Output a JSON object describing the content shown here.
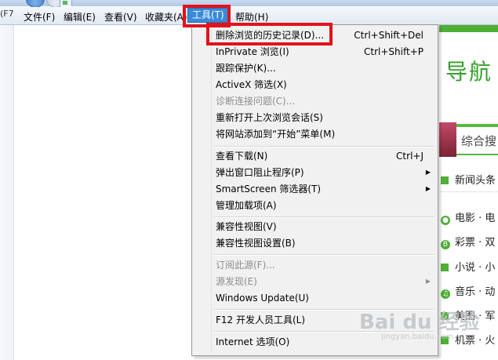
{
  "window": {
    "side_label": "(F7"
  },
  "menubar": {
    "items": [
      {
        "label": "文件(F)"
      },
      {
        "label": "编辑(E)"
      },
      {
        "label": "查看(V)"
      },
      {
        "label": "收藏夹(A)"
      },
      {
        "label": "工具(T)"
      },
      {
        "label": "帮助(H)"
      }
    ]
  },
  "tools_menu": {
    "items": [
      {
        "label": "删除浏览的历史记录(D)...",
        "shortcut": "Ctrl+Shift+Del",
        "disabled": false
      },
      {
        "label": "InPrivate 浏览(I)",
        "shortcut": "Ctrl+Shift+P",
        "disabled": false
      },
      {
        "label": "跟踪保护(K)...",
        "shortcut": "",
        "disabled": false
      },
      {
        "label": "ActiveX 筛选(X)",
        "shortcut": "",
        "disabled": false
      },
      {
        "label": "诊断连接问题(C)...",
        "shortcut": "",
        "disabled": true
      },
      {
        "label": "重新打开上次浏览会话(S)",
        "shortcut": "",
        "disabled": false
      },
      {
        "label": "将网站添加到“开始”菜单(M)",
        "shortcut": "",
        "disabled": false
      },
      {
        "label": "查看下载(N)",
        "shortcut": "Ctrl+J",
        "disabled": false
      },
      {
        "label": "弹出窗口阻止程序(P)",
        "shortcut": "",
        "submenu": true,
        "disabled": false
      },
      {
        "label": "SmartScreen 筛选器(T)",
        "shortcut": "",
        "submenu": true,
        "disabled": false
      },
      {
        "label": "管理加载项(A)",
        "shortcut": "",
        "disabled": false
      },
      {
        "label": "兼容性视图(V)",
        "shortcut": "",
        "disabled": false
      },
      {
        "label": "兼容性视图设置(B)",
        "shortcut": "",
        "disabled": false
      },
      {
        "label": "订阅此源(F)...",
        "shortcut": "",
        "disabled": true
      },
      {
        "label": "源发现(E)",
        "shortcut": "",
        "submenu": true,
        "disabled": true
      },
      {
        "label": "Windows Update(U)",
        "shortcut": "",
        "disabled": false
      },
      {
        "label": "F12 开发人员工具(L)",
        "shortcut": "",
        "disabled": false
      },
      {
        "label": "Internet 选项(O)",
        "shortcut": "",
        "disabled": false
      }
    ],
    "submenu_arrow": "▶"
  },
  "page": {
    "logo_text": "导航",
    "search_text": "综合搜",
    "links": [
      {
        "label": "新闻头条"
      },
      {
        "label": "电影 · 电"
      },
      {
        "label": "彩票 · 双"
      },
      {
        "label": "小说 · 小"
      },
      {
        "label": "音乐 · 动"
      },
      {
        "label": "美图 · 军"
      },
      {
        "label": "机票 · 火"
      }
    ],
    "link_icons": [
      "▣",
      "●",
      "B",
      "▮",
      "♫",
      "▣",
      "✈"
    ]
  },
  "watermark": {
    "text": "Bai du 经验",
    "sub": "jingyan.baidu.com"
  },
  "colors": {
    "highlight_box": "#e1131b",
    "menu_active": "#3b8ad9",
    "site_green": "#4fae35"
  }
}
